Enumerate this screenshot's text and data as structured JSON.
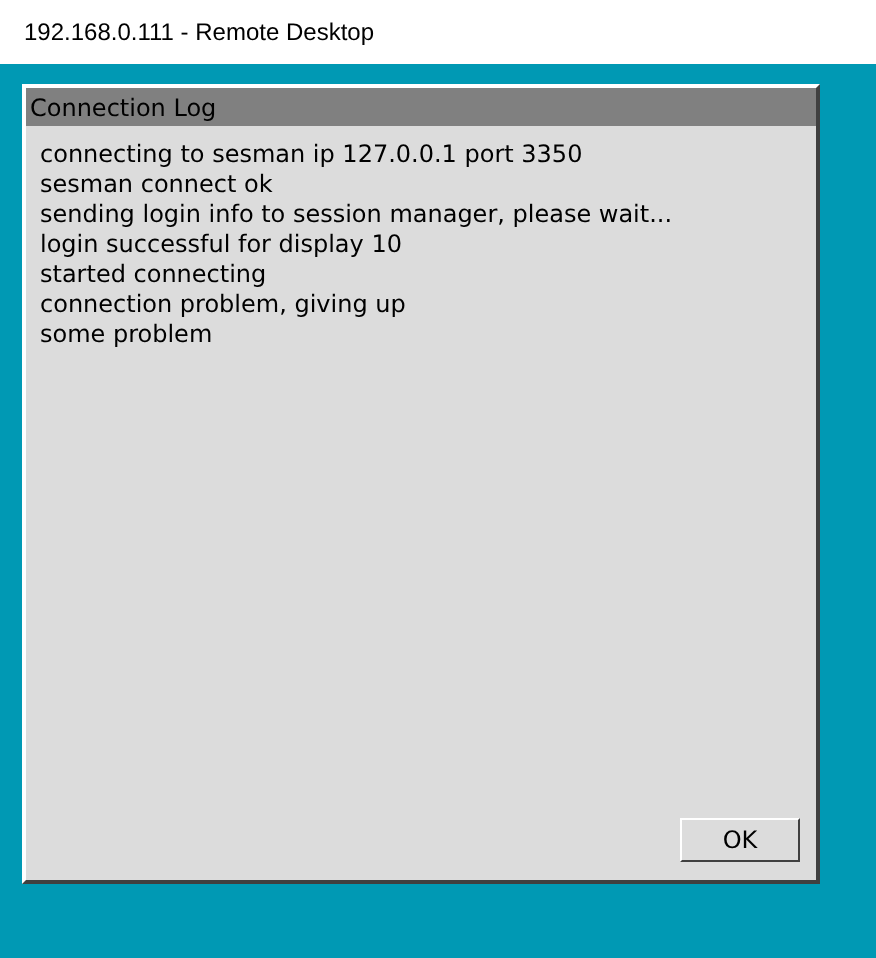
{
  "window": {
    "title": "192.168.0.111 - Remote Desktop"
  },
  "dialog": {
    "title": "Connection Log",
    "log_lines": [
      "connecting to sesman ip 127.0.0.1 port 3350",
      "sesman connect ok",
      "sending login info to session manager, please wait...",
      "login successful for display 10",
      "started connecting",
      "connection problem, giving up",
      "some problem"
    ],
    "buttons": [
      "OK"
    ]
  }
}
